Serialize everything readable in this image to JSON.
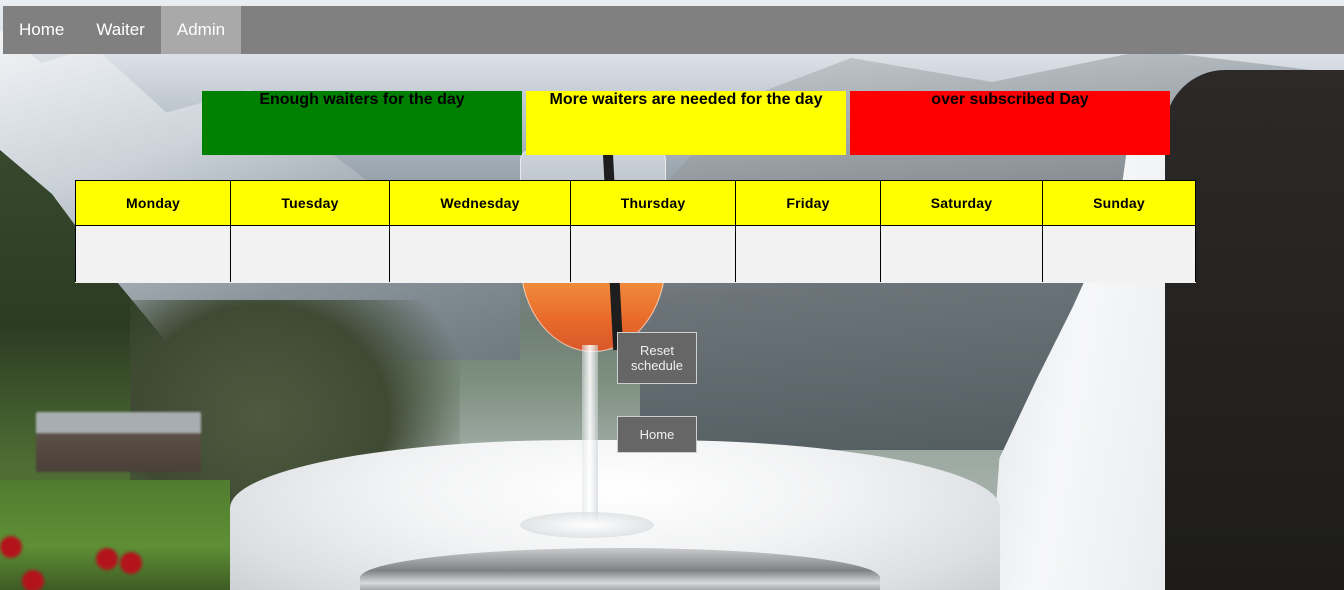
{
  "nav": {
    "items": [
      {
        "label": "Home",
        "active": false
      },
      {
        "label": "Waiter",
        "active": false
      },
      {
        "label": "Admin",
        "active": true
      }
    ]
  },
  "legend": {
    "enough": {
      "label": "Enough waiters for the day",
      "color": "#008000"
    },
    "needed": {
      "label": "More waiters are needed for the day",
      "color": "#ffff00"
    },
    "over": {
      "label": "over subscribed Day",
      "color": "#ff0000"
    }
  },
  "schedule": {
    "header_color": "#ffff00",
    "days": [
      "Monday",
      "Tuesday",
      "Wednesday",
      "Thursday",
      "Friday",
      "Saturday",
      "Sunday"
    ]
  },
  "buttons": {
    "reset_label": "Reset schedule",
    "home_label": "Home"
  }
}
